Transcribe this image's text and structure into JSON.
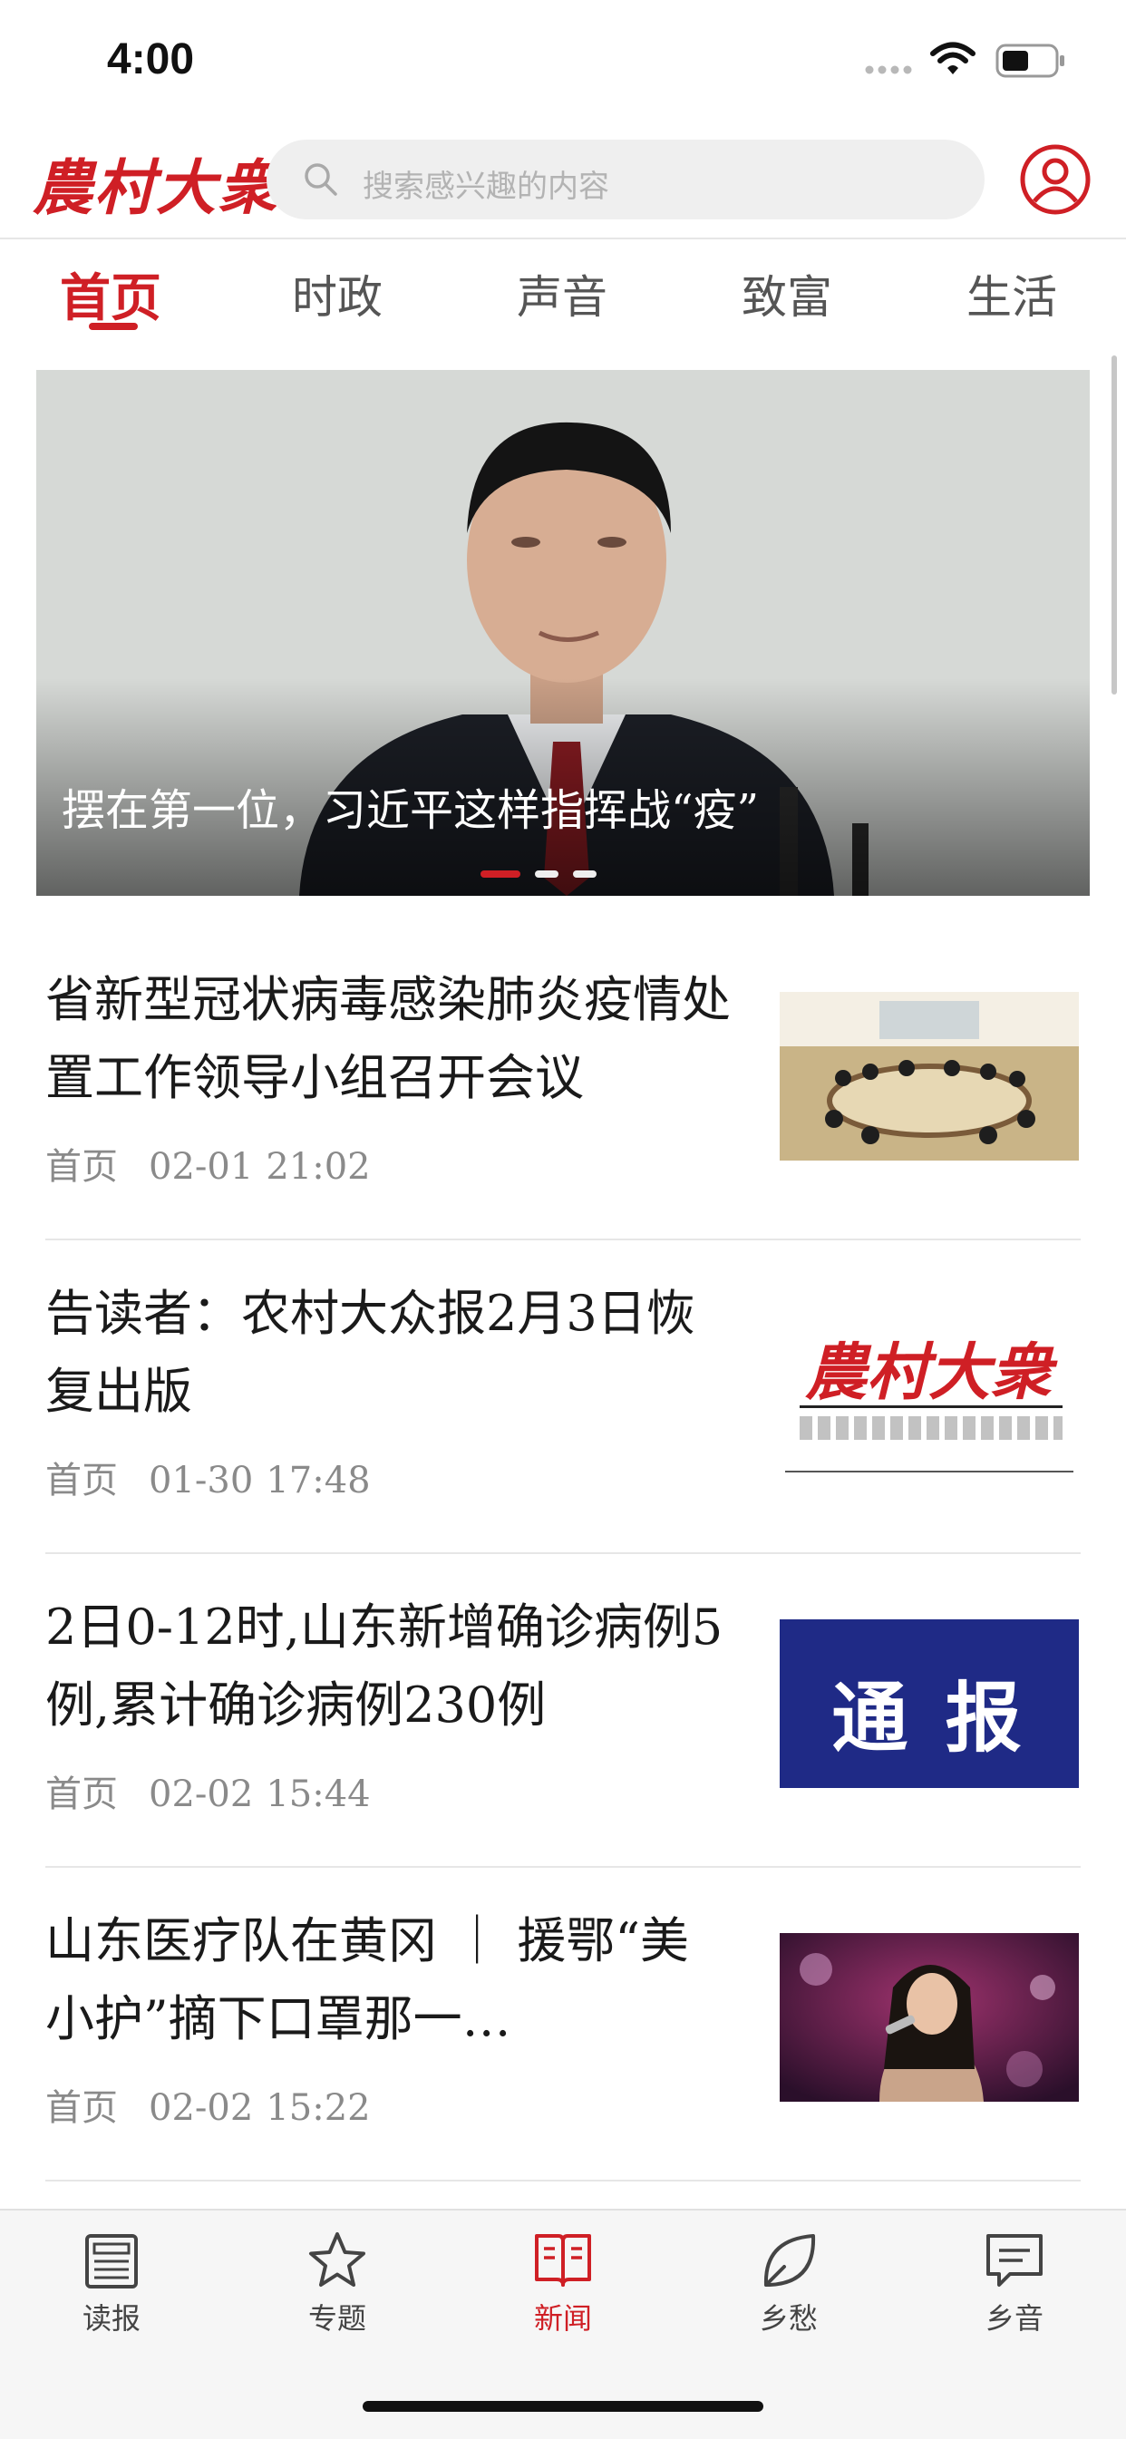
{
  "status_bar": {
    "time": "4:00"
  },
  "header": {
    "logo_text": "農村大衆",
    "search_placeholder": "搜索感兴趣的内容"
  },
  "tabs": [
    {
      "label": "首页",
      "active": true
    },
    {
      "label": "时政",
      "active": false
    },
    {
      "label": "声音",
      "active": false
    },
    {
      "label": "致富",
      "active": false
    },
    {
      "label": "生活",
      "active": false
    }
  ],
  "banner": {
    "caption": "摆在第一位，习近平这样指挥战“疫”",
    "slide_count": 3,
    "active_slide": 1
  },
  "news": [
    {
      "title": "省新型冠状病毒感染肺炎疫情处置工作领导小组召开会议",
      "channel": "首页",
      "date": "02-01",
      "time": "21:02"
    },
    {
      "title": "告读者：农村大众报2月3日恢复出版",
      "channel": "首页",
      "date": "01-30",
      "time": "17:48",
      "thumb_text": "農村大衆"
    },
    {
      "title": "2日0-12时,山东新增确诊病例5例,累计确诊病例230例",
      "channel": "首页",
      "date": "02-02",
      "time": "15:44",
      "thumb_text": "通 报"
    },
    {
      "title": "山东医疗队在黄冈 ｜ 援鄂“美小护”摘下口罩那一…",
      "channel": "首页",
      "date": "02-02",
      "time": "15:22"
    }
  ],
  "bottom_nav": [
    {
      "label": "读报",
      "icon": "newspaper-icon",
      "active": false
    },
    {
      "label": "专题",
      "icon": "star-icon",
      "active": false
    },
    {
      "label": "新闻",
      "icon": "open-book-icon",
      "active": true
    },
    {
      "label": "乡愁",
      "icon": "leaf-icon",
      "active": false
    },
    {
      "label": "乡音",
      "icon": "message-icon",
      "active": false
    }
  ],
  "colors": {
    "accent": "#cf1f25",
    "navy": "#1f2a86"
  }
}
